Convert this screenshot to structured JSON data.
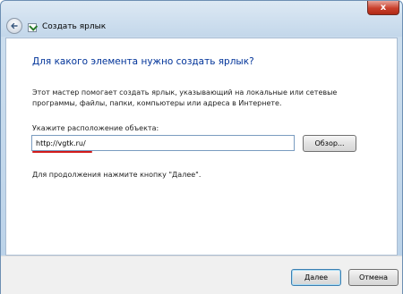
{
  "window": {
    "title": "Создать ярлык",
    "close_glyph": "x"
  },
  "content": {
    "heading": "Для какого элемента нужно создать ярлык?",
    "description": "Этот мастер помогает создать ярлык, указывающий на локальные или сетевые программы, файлы, папки, компьютеры или адреса в Интернете.",
    "location_label": "Укажите расположение объекта:",
    "location_value": "http://vgtk.ru/",
    "browse_label": "Обзор...",
    "hint": "Для продолжения нажмите кнопку \"Далее\"."
  },
  "footer": {
    "next_label": "Далее",
    "cancel_label": "Отмена"
  },
  "colors": {
    "heading": "#003399",
    "annotation_underline": "#d11a1a"
  },
  "icons": {
    "back": "back-arrow-icon",
    "wizard": "shortcut-wizard-icon",
    "close": "close-icon"
  }
}
